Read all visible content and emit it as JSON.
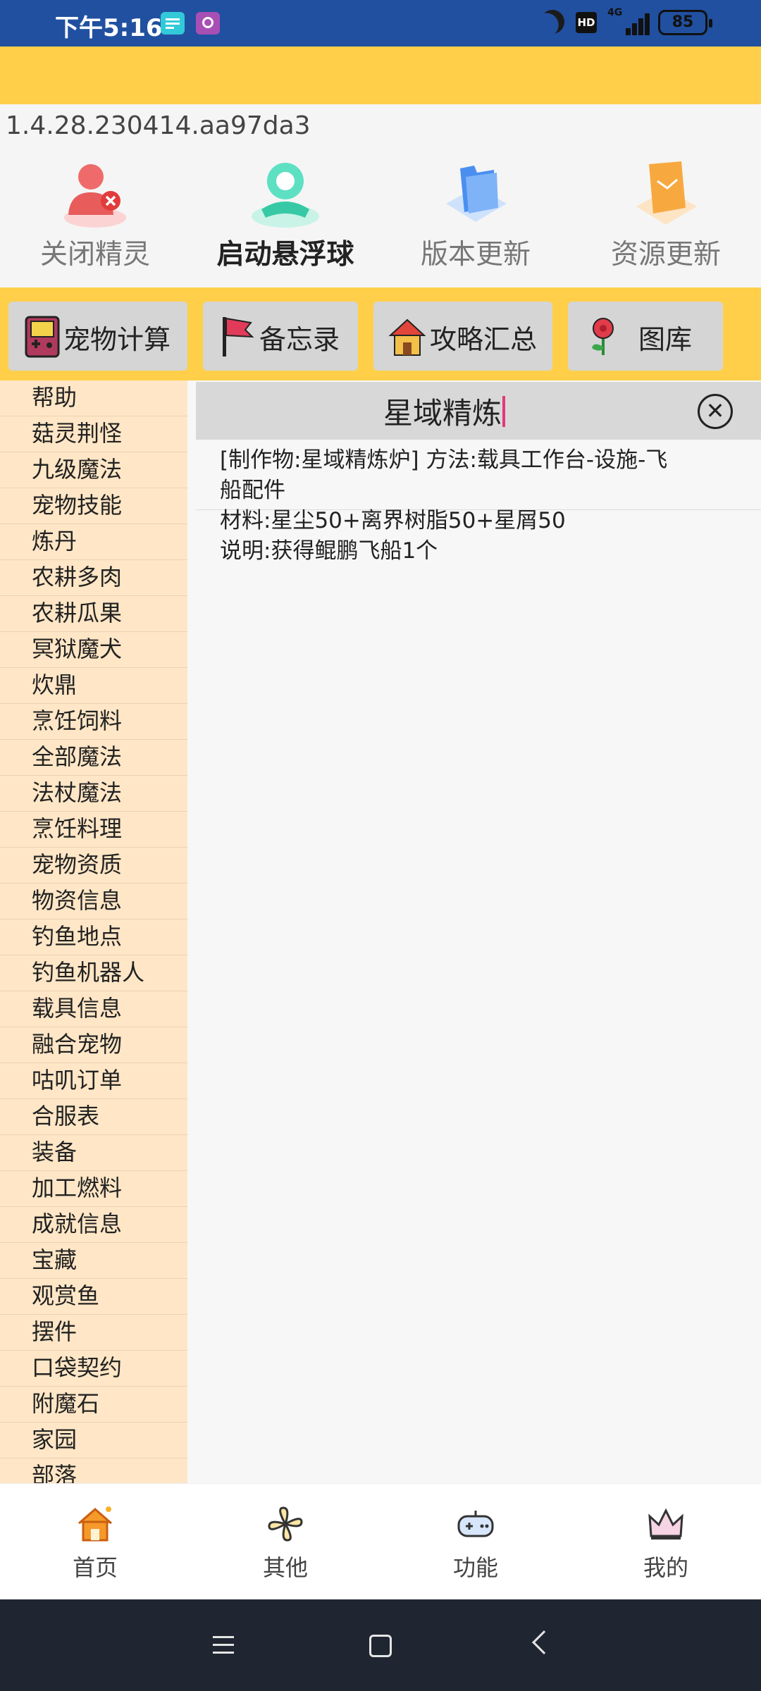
{
  "status": {
    "time": "下午5:16",
    "hd": "HD",
    "network": "4G",
    "battery": "85"
  },
  "version": "1.4.28.230414.aa97da3",
  "top_actions": [
    {
      "label": "关闭精灵",
      "icon": "close-sprite-icon"
    },
    {
      "label": "启动悬浮球",
      "icon": "floating-ball-icon"
    },
    {
      "label": "版本更新",
      "icon": "folder-icon"
    },
    {
      "label": "资源更新",
      "icon": "resource-folder-icon"
    }
  ],
  "tools": [
    {
      "label": "宠物计算",
      "icon": "gameboy-icon"
    },
    {
      "label": "备忘录",
      "icon": "flag-icon"
    },
    {
      "label": "攻略汇总",
      "icon": "house-icon"
    },
    {
      "label": "图库",
      "icon": "flower-icon"
    }
  ],
  "sidebar": {
    "items": [
      "帮助",
      "菇灵荆怪",
      "九级魔法",
      "宠物技能",
      "炼丹",
      "农耕多肉",
      "农耕瓜果",
      "冥狱魔犬",
      "炊鼎",
      "烹饪饲料",
      "全部魔法",
      "法杖魔法",
      "烹饪料理",
      "宠物资质",
      "物资信息",
      "钓鱼地点",
      "钓鱼机器人",
      "载具信息",
      "融合宠物",
      "咕叽订单",
      "合服表",
      "装备",
      "加工燃料",
      "成就信息",
      "宝藏",
      "观赏鱼",
      "摆件",
      "口袋契约",
      "附魔石",
      "家园",
      "部落"
    ]
  },
  "search": {
    "value": "星域精炼"
  },
  "result": {
    "line1": "[制作物:星域精炼炉] 方法:载具工作台-设施-飞",
    "line2": "船配件",
    "line3": "材料:星尘50+离界树脂50+星屑50",
    "line4": "说明:获得鲲鹏飞船1个"
  },
  "bottom_nav": [
    {
      "label": "首页",
      "icon": "home-icon"
    },
    {
      "label": "其他",
      "icon": "pinwheel-icon"
    },
    {
      "label": "功能",
      "icon": "gamepad-icon"
    },
    {
      "label": "我的",
      "icon": "crown-icon"
    }
  ]
}
